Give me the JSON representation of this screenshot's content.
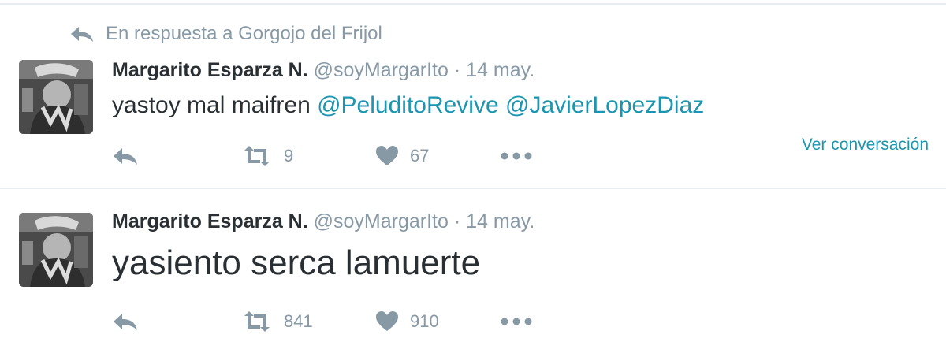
{
  "tweets": [
    {
      "in_reply_to": "En respuesta a Gorgojo del Frijol",
      "name": "Margarito Esparza N.",
      "handle": "@soyMargarIto",
      "separator": "·",
      "time": "14 may.",
      "text": "yastoy mal maifren ",
      "mention1": "@PeluditoRevive",
      "mention2": "@JavierLopezDiaz",
      "retweets": "9",
      "likes": "67",
      "conversation_link": "Ver conversación"
    },
    {
      "name": "Margarito Esparza N.",
      "handle": "@soyMargarIto",
      "separator": "·",
      "time": "14 may.",
      "text": "yasiento serca lamuerte",
      "retweets": "841",
      "likes": "910"
    }
  ],
  "icons": {
    "reply": "reply-icon",
    "retweet": "retweet-icon",
    "like": "heart-icon",
    "more": "more-icon"
  },
  "colors": {
    "muted": "#8899a6",
    "link": "#1b95b0",
    "text": "#292f33",
    "divider": "#e6ecf0"
  }
}
